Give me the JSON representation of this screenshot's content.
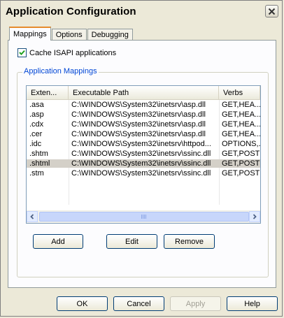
{
  "window": {
    "title": "Application Configuration"
  },
  "tabs": [
    {
      "label": "Mappings",
      "active": true
    },
    {
      "label": "Options",
      "active": false
    },
    {
      "label": "Debugging",
      "active": false
    }
  ],
  "cache_checkbox": {
    "label": "Cache ISAPI applications",
    "checked": true
  },
  "group": {
    "label": "Application Mappings"
  },
  "listview": {
    "columns": [
      "Exten...",
      "Executable Path",
      "Verbs"
    ],
    "rows": [
      {
        "ext": ".asa",
        "path": "C:\\WINDOWS\\System32\\inetsrv\\asp.dll",
        "verbs": "GET,HEA..."
      },
      {
        "ext": ".asp",
        "path": "C:\\WINDOWS\\System32\\inetsrv\\asp.dll",
        "verbs": "GET,HEA..."
      },
      {
        "ext": ".cdx",
        "path": "C:\\WINDOWS\\System32\\inetsrv\\asp.dll",
        "verbs": "GET,HEA..."
      },
      {
        "ext": ".cer",
        "path": "C:\\WINDOWS\\System32\\inetsrv\\asp.dll",
        "verbs": "GET,HEA..."
      },
      {
        "ext": ".idc",
        "path": "C:\\WINDOWS\\System32\\inetsrv\\httpod...",
        "verbs": "OPTIONS,..."
      },
      {
        "ext": ".shtm",
        "path": "C:\\WINDOWS\\System32\\inetsrv\\ssinc.dll",
        "verbs": "GET,POST"
      },
      {
        "ext": ".shtml",
        "path": "C:\\WINDOWS\\System32\\inetsrv\\ssinc.dll",
        "verbs": "GET,POST",
        "selected": true
      },
      {
        "ext": ".stm",
        "path": "C:\\WINDOWS\\System32\\inetsrv\\ssinc.dll",
        "verbs": "GET,POST"
      }
    ]
  },
  "mapping_buttons": {
    "add": "Add",
    "edit": "Edit",
    "remove": "Remove"
  },
  "dialog_buttons": {
    "ok": "OK",
    "cancel": "Cancel",
    "apply": "Apply",
    "help": "Help"
  }
}
